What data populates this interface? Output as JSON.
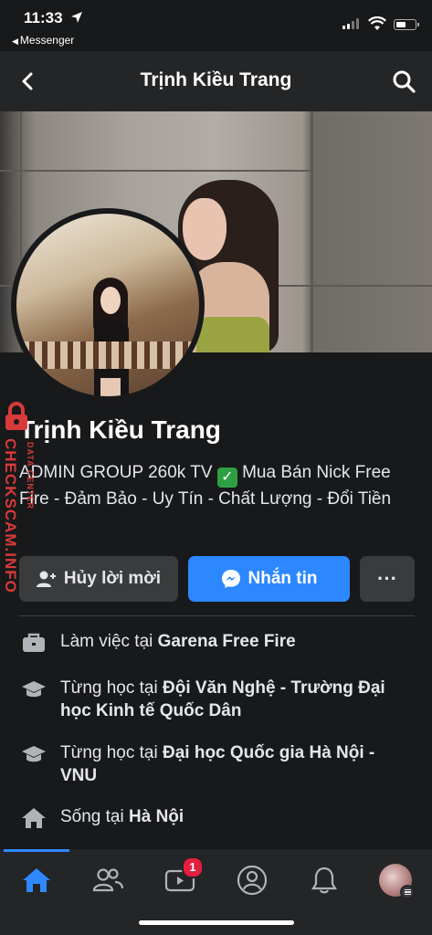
{
  "status_bar": {
    "time": "11:33",
    "back_app": "Messenger"
  },
  "nav": {
    "title": "Trịnh Kiều Trang"
  },
  "profile": {
    "name": "Trịnh Kiều Trang",
    "bio_part1": "ADMIN GROUP 260k TV ",
    "bio_check": "✓",
    "bio_part2": " Mua Bán Nick Free Fire - Đảm Bảo - Uy Tín - Chất Lượng - Đổi Tiền"
  },
  "watermark": {
    "main": "CHECKSCAM.INFO",
    "small": "DATA CENTER"
  },
  "actions": {
    "cancel_request": "Hủy lời mời",
    "message": "Nhắn tin",
    "more": "···"
  },
  "info": [
    {
      "icon": "briefcase-icon",
      "prefix": "Làm việc tại ",
      "value": "Garena Free Fire"
    },
    {
      "icon": "graduation-cap-icon",
      "prefix": "Từng học tại ",
      "value": "Đội Văn Nghệ - Trường Đại học Kinh tế Quốc Dân"
    },
    {
      "icon": "graduation-cap-icon",
      "prefix": "Từng học tại ",
      "value": "Đại học Quốc gia Hà Nội - VNU"
    },
    {
      "icon": "home-icon",
      "prefix": "Sống tại ",
      "value": "Hà Nội"
    }
  ],
  "tabbar": {
    "video_badge": "1"
  },
  "colors": {
    "background": "#18191a",
    "surface": "#242526",
    "accent": "#2d88ff",
    "badge": "#e41e3f",
    "watermark": "#d83a3a"
  }
}
